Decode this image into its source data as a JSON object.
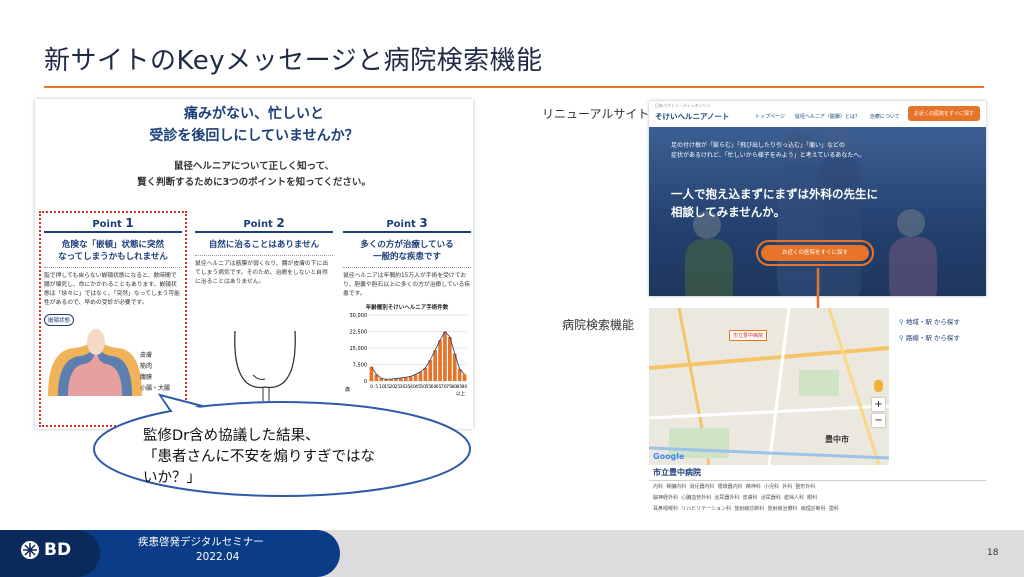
{
  "slide": {
    "title": "新サイトのKeyメッセージと病院検索機能",
    "page_number": "18"
  },
  "leaflet": {
    "headline_1": "痛みがない、忙しいと",
    "headline_2": "受診を後回しにしていませんか？",
    "sub_1": "鼠径ヘルニアについて正しく知って、",
    "sub_2": "賢く判断するために3つのポイントを知ってください。",
    "points": [
      {
        "tab": "Point",
        "num": "1",
        "head_1": "危険な「嵌頓」状態に突然",
        "head_2": "なってしまうかもしれません",
        "body": "脂で押しても戻らない嵌頓状態になると、数時間で腸が壊死し、命にかかわることもあります。嵌頓状態は「徐々に」ではなく、「突然」なってしまう可能性があるので、早めの受診が必要です。"
      },
      {
        "tab": "Point",
        "num": "2",
        "head_1": "自然に治ることはありません",
        "head_2": "",
        "body": "鼠径ヘルニアは筋膜が弱くなり、腸が皮膚の下に出てしまう病気です。そのため、治療をしないと自然に治ることはありません。"
      },
      {
        "tab": "Point",
        "num": "3",
        "head_1": "多くの方が治療している",
        "head_2": "一般的な疾患です",
        "body": "鼠径ヘルニアは年間約15万人が手術を受けており、胆嚢や胆石以上に多くの方が治療している疾患です。"
      }
    ],
    "diagram_label": "嵌頓状態",
    "diagram_layers": [
      "皮膚",
      "筋肉",
      "腹膜",
      "小腸・大腸"
    ],
    "chart_title": "年齢層別そけいヘルニア手術件数",
    "y_ticks": [
      "30,000",
      "22,500",
      "15,000",
      "7,500",
      "0"
    ],
    "x_ticks": [
      "0",
      "5",
      "10",
      "15",
      "20",
      "25",
      "30",
      "35",
      "40",
      "45",
      "50",
      "55",
      "60",
      "65",
      "70",
      "75",
      "80",
      "85",
      "90"
    ],
    "x_last": "以上",
    "y_axis_word": "歳",
    "age_bar_values": [
      6500,
      3000,
      1200,
      800,
      900,
      1100,
      1400,
      1700,
      2100,
      3000,
      4200,
      6000,
      9500,
      14000,
      18500,
      22500,
      20000,
      12500,
      5500,
      3000
    ]
  },
  "callout": {
    "line_1": "監修Dr含め協議した結果、",
    "line_2": "「患者さんに不安を煽りすぎではな",
    "line_3": "いか？」"
  },
  "labels": {
    "renewal": "リニューアルサイト",
    "search": "病院検索機能"
  },
  "site": {
    "logo": "そけいヘルニアノート",
    "nav": [
      "トップページ",
      "鼠径ヘルニア（脱腸）とは？",
      "治療について"
    ],
    "cta_top": "お近くの医院をすぐに探す",
    "intro_1": "足の付け根が「膨らむ」「飛び出したり引っ込む」「痛い」などの",
    "intro_2": "症状があるけれど、「忙しいから様子をみよう」と考えているあなたへ。",
    "main_1": "一人で抱え込まずにまずは外科の先生に",
    "main_2": "相談してみませんか。",
    "cta_hero": "お近くの医院をすぐに探す"
  },
  "map": {
    "options": [
      "地域・駅 から探す",
      "路線・駅 から探す"
    ],
    "city_label": "豊中市",
    "station_label": "市立豊中病院",
    "google": "Google",
    "zoom_in": "+",
    "zoom_out": "−"
  },
  "hospital": {
    "name": "市立豊中病院",
    "row_1": [
      "内科",
      "腎臓内科",
      "消化器内科",
      "循環器内科",
      "精神科",
      "小児科",
      "外科",
      "整形外科"
    ],
    "row_2": [
      "脳神経外科",
      "心臓血管外科",
      "泌尿器外科",
      "皮膚科",
      "泌尿器科",
      "産婦人科",
      "眼科"
    ],
    "row_3": [
      "耳鼻咽喉科",
      "リハビリテーション科",
      "放射線診断科",
      "放射線治療科",
      "病理診断科",
      "歯科"
    ]
  },
  "footer": {
    "logo": "BD",
    "seminar": "疾患啓発デジタルセミナー",
    "date": "2022.04"
  },
  "colors": {
    "accent": "#e8742a",
    "navy": "#1b3f7a",
    "footer_blue": "#0b3c87",
    "dotted_red": "#d9302a"
  }
}
